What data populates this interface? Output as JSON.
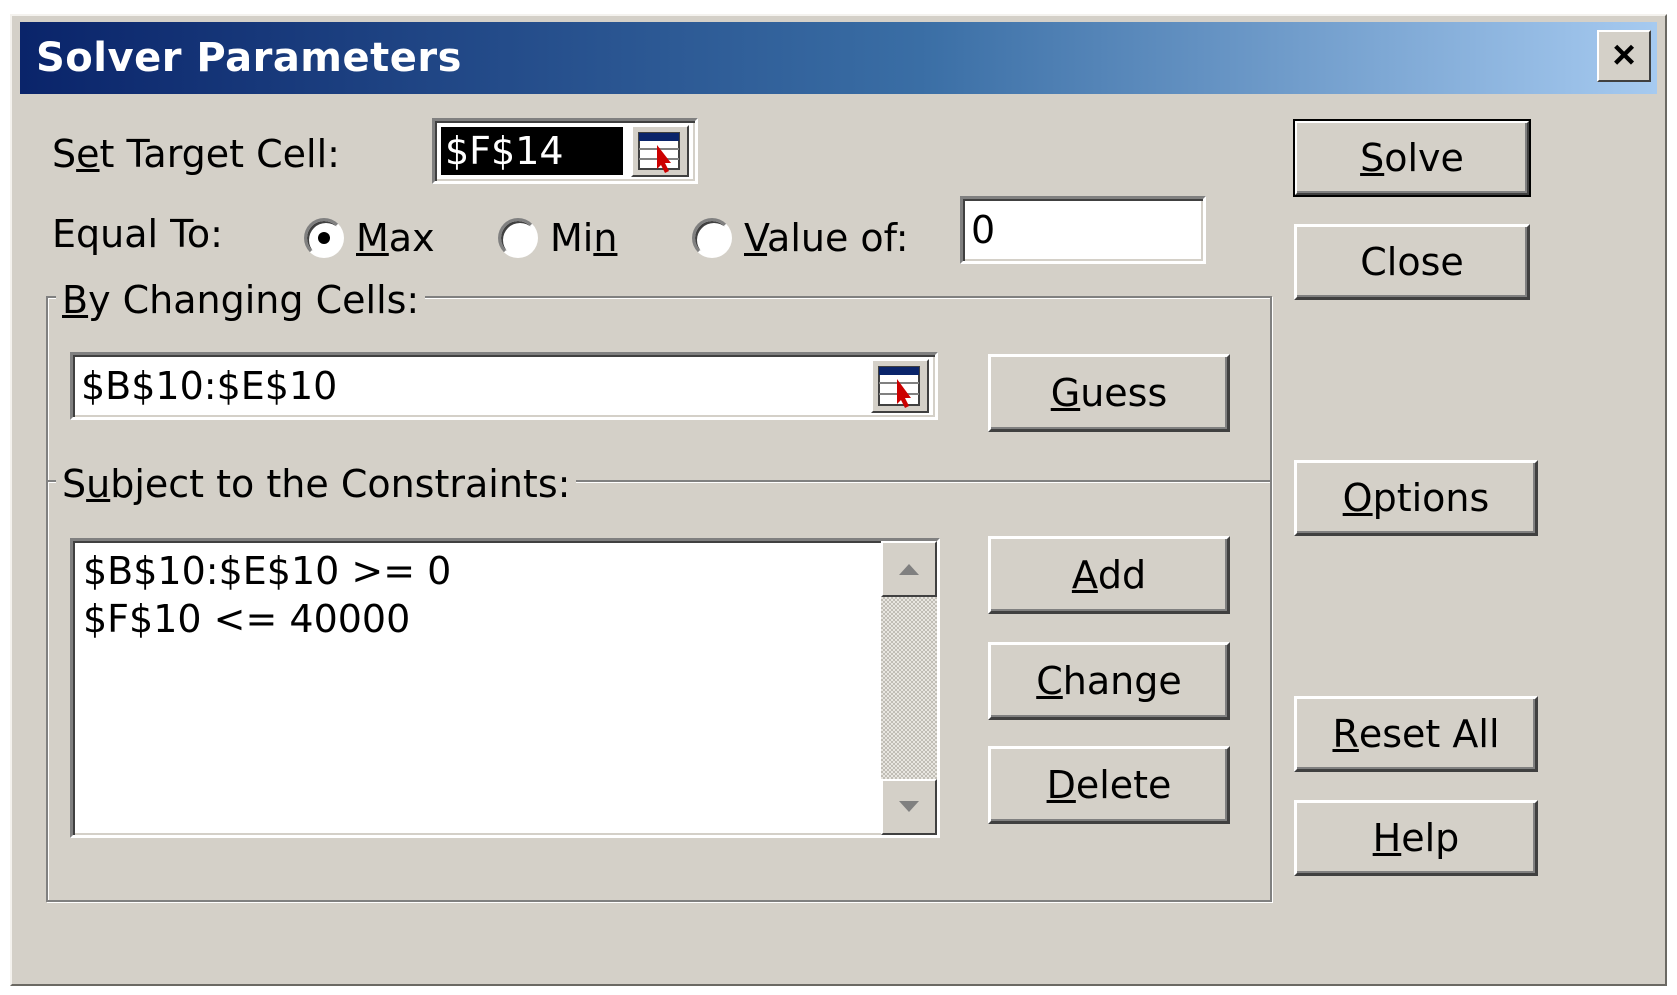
{
  "window": {
    "title": "Solver Parameters",
    "close_glyph": "×"
  },
  "target_cell": {
    "label_pre": "S",
    "label_ul": "e",
    "label_post": "t Target Cell:",
    "value": "$F$14"
  },
  "equal_to": {
    "label": "Equal To:",
    "options": [
      {
        "pre": "",
        "ul": "M",
        "post": "ax",
        "selected": true
      },
      {
        "pre": "Mi",
        "ul": "n",
        "post": "",
        "selected": false
      },
      {
        "pre": "",
        "ul": "V",
        "post": "alue of:",
        "selected": false
      }
    ],
    "value_of": "0"
  },
  "changing_cells": {
    "label_pre": "",
    "label_ul": "B",
    "label_post": "y Changing Cells:",
    "value": "$B$10:$E$10"
  },
  "constraints": {
    "label_pre": "S",
    "label_ul": "u",
    "label_post": "bject to the Constraints:",
    "items": [
      "$B$10:$E$10 >= 0",
      "$F$10 <= 40000"
    ]
  },
  "buttons": {
    "solve": {
      "pre": "",
      "ul": "S",
      "post": "olve"
    },
    "close": {
      "pre": "Close",
      "ul": "",
      "post": ""
    },
    "options": {
      "pre": "",
      "ul": "O",
      "post": "ptions"
    },
    "reset_all": {
      "pre": "",
      "ul": "R",
      "post": "eset All"
    },
    "help": {
      "pre": "",
      "ul": "H",
      "post": "elp"
    },
    "guess": {
      "pre": "",
      "ul": "G",
      "post": "uess"
    },
    "add": {
      "pre": "",
      "ul": "A",
      "post": "dd"
    },
    "change": {
      "pre": "",
      "ul": "C",
      "post": "hange"
    },
    "delete": {
      "pre": "",
      "ul": "D",
      "post": "elete"
    }
  },
  "icons": {
    "refedit": "range-selector-icon",
    "scroll_up": "scroll-up-arrow-icon",
    "scroll_down": "scroll-down-arrow-icon"
  }
}
